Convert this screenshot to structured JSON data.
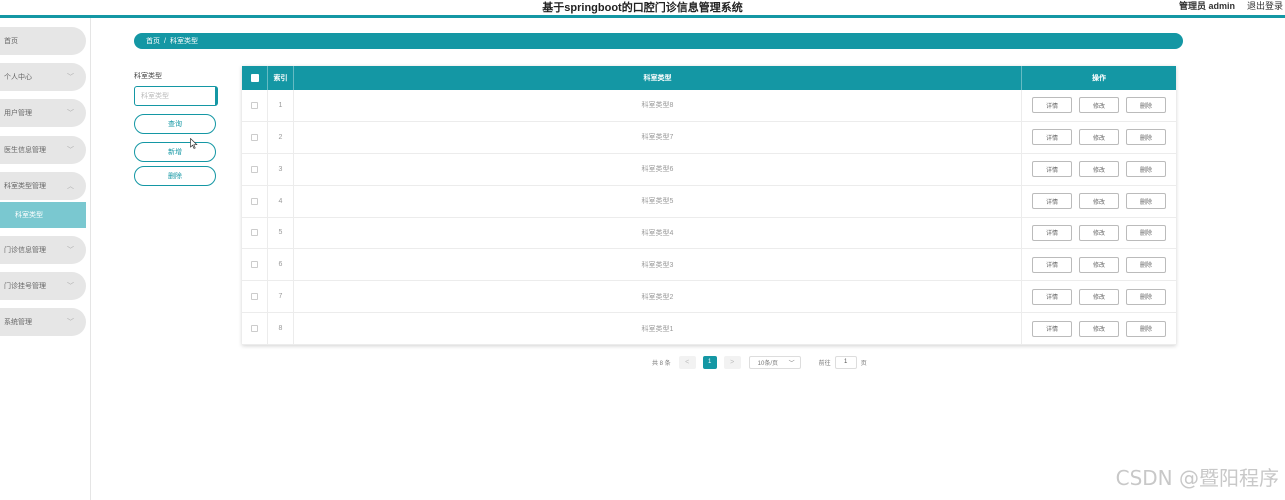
{
  "header": {
    "title": "基于springboot的口腔门诊信息管理系统",
    "user": "管理员 admin",
    "logout": "退出登录"
  },
  "sidebar": {
    "items": [
      {
        "label": "首页",
        "has_children": false
      },
      {
        "label": "个人中心",
        "has_children": true,
        "chevron": "﹀"
      },
      {
        "label": "用户管理",
        "has_children": true,
        "chevron": "﹀"
      },
      {
        "label": "医生信息管理",
        "has_children": true,
        "chevron": "﹀"
      },
      {
        "label": "科室类型管理",
        "has_children": true,
        "chevron": "︿",
        "expanded": true,
        "sub": {
          "label": "科室类型"
        }
      },
      {
        "label": "门诊信息管理",
        "has_children": true,
        "chevron": "﹀"
      },
      {
        "label": "门诊挂号管理",
        "has_children": true,
        "chevron": "﹀"
      },
      {
        "label": "系统管理",
        "has_children": true,
        "chevron": "﹀"
      }
    ]
  },
  "breadcrumb": {
    "home": "首页",
    "separator": "/",
    "current": "科室类型"
  },
  "search": {
    "label": "科室类型",
    "placeholder": "科室类型",
    "query_button": "查询",
    "add_button": "新增",
    "delete_button": "删除"
  },
  "table": {
    "columns": {
      "index": "索引",
      "name": "科室类型",
      "actions": "操作"
    },
    "action_labels": {
      "detail": "详情",
      "edit": "修改",
      "delete": "删除"
    },
    "rows": [
      {
        "index": "1",
        "name": "科室类型8"
      },
      {
        "index": "2",
        "name": "科室类型7"
      },
      {
        "index": "3",
        "name": "科室类型6"
      },
      {
        "index": "4",
        "name": "科室类型5"
      },
      {
        "index": "5",
        "name": "科室类型4"
      },
      {
        "index": "6",
        "name": "科室类型3"
      },
      {
        "index": "7",
        "name": "科室类型2"
      },
      {
        "index": "8",
        "name": "科室类型1"
      }
    ]
  },
  "pagination": {
    "total": "共 8 条",
    "prev": "<",
    "current_page": "1",
    "next": ">",
    "page_size": "10条/页",
    "goto_label": "前往",
    "goto_value": "1",
    "page_unit": "页"
  },
  "watermark": "CSDN @暨阳程序",
  "colors": {
    "accent": "#1497a4",
    "sidebar_active": "#7ac8d0",
    "sidebar_item": "#e6e6e6"
  }
}
